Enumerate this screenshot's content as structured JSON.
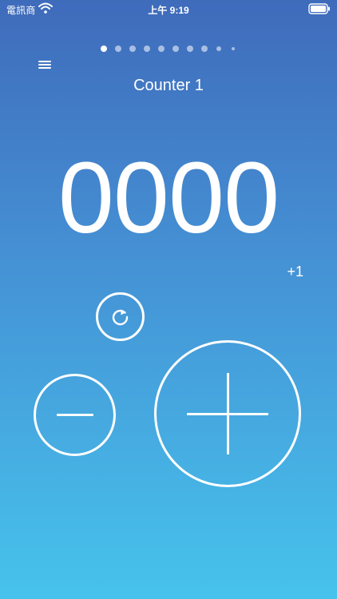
{
  "status_bar": {
    "carrier": "電訊商",
    "time": "上午 9:19"
  },
  "page_indicator": {
    "page_count": 10,
    "active_index": 0
  },
  "icons": {
    "menu": "hamburger-icon",
    "reset": "refresh-icon",
    "minus": "minus-icon",
    "plus": "plus-icon",
    "wifi": "wifi-icon",
    "battery": "battery-icon"
  },
  "counter": {
    "title": "Counter 1",
    "value": "0000",
    "step_label": "+1"
  },
  "colors": {
    "gradient_top": "#3f6bbb",
    "gradient_bottom": "#46c3ec",
    "foreground": "#ffffff"
  }
}
